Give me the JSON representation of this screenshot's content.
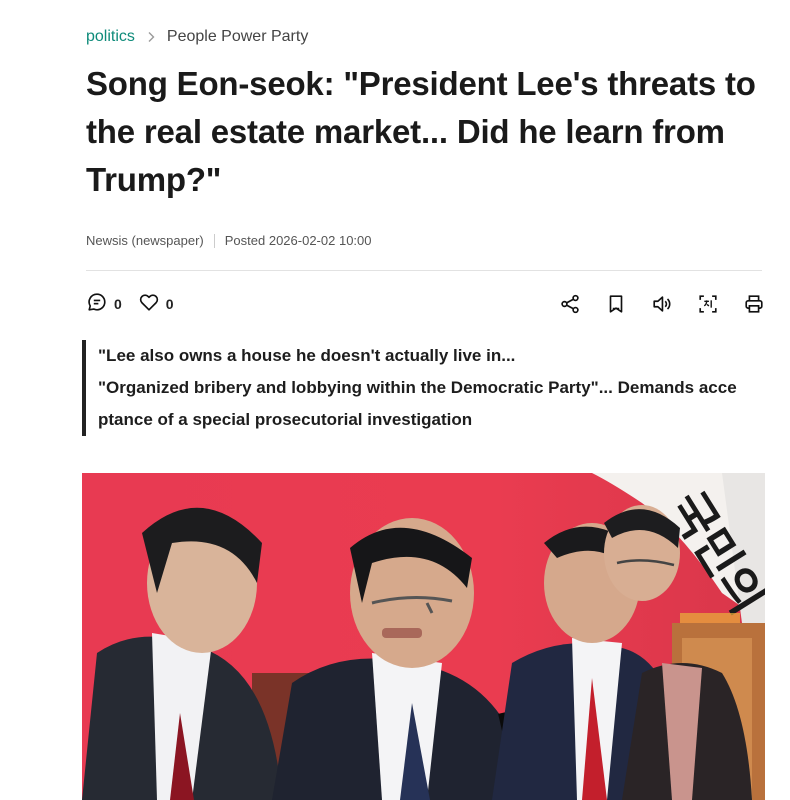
{
  "breadcrumb": {
    "section": "politics",
    "subsection": "People Power Party"
  },
  "article": {
    "headline": "Song Eon-seok: \"President Lee's threats to the real estate market... Did he learn from Trump?\"",
    "source": "Newsis (newspaper)",
    "posted": "Posted 2026-02-02 10:00",
    "summary": [
      "\"Lee also owns a house he doesn't actually live in...",
      "\"Organized bribery and lobbying within the Democratic Party\"... Demands acce",
      "ptance of a special prosecutorial investigation"
    ]
  },
  "reactions": {
    "comments_count": "0",
    "likes_count": "0"
  },
  "tools": [
    "share-icon",
    "bookmark-icon",
    "listen-icon",
    "translate-icon",
    "print-icon"
  ],
  "colors": {
    "accent": "#0e8b7a",
    "photo_background": "#e8364e"
  },
  "photo": {
    "banner_text": "국민의"
  }
}
